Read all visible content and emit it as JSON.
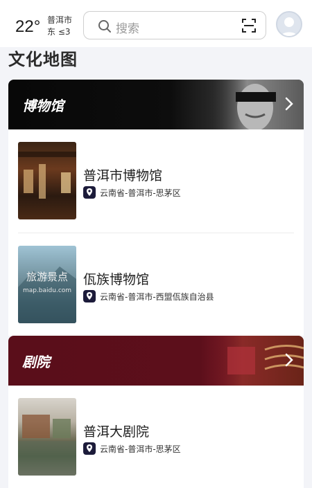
{
  "weather": {
    "temperature": "22°",
    "city": "普洱市",
    "wind": "东 ≤3"
  },
  "search": {
    "placeholder": "搜索"
  },
  "section_title": "文化地图",
  "categories": [
    {
      "label": "博物馆",
      "items": [
        {
          "name": "普洱市博物馆",
          "address": "云南省-普洱市-思茅区"
        },
        {
          "name": "佤族博物馆",
          "address": "云南省-普洱市-西盟佤族自治县",
          "thumb_title": "旅游景点",
          "thumb_url": "map.baidu.com"
        }
      ]
    },
    {
      "label": "剧院",
      "items": [
        {
          "name": "普洱大剧院",
          "address": "云南省-普洱市-思茅区"
        }
      ]
    }
  ]
}
